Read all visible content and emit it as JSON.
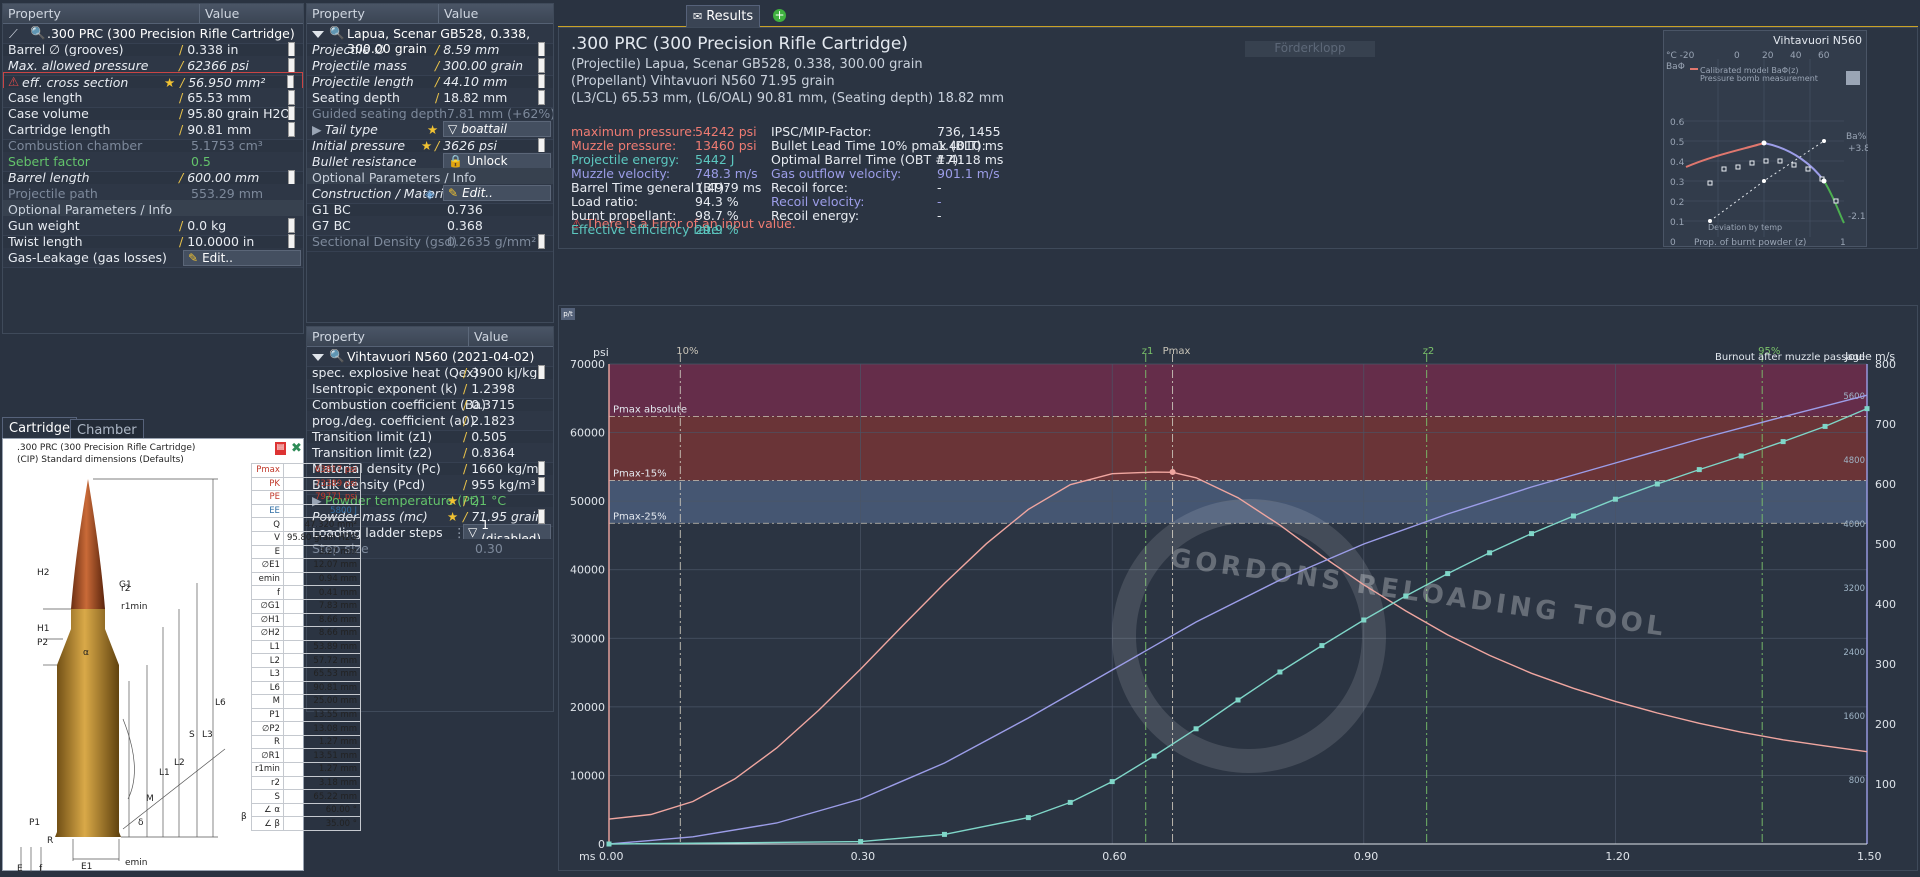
{
  "cartridge_panel": {
    "header": {
      "property": "Property",
      "value": "Value"
    },
    "title": ".300 PRC (300 Precision Rifle Cartridge)",
    "rows": [
      {
        "label": "Barrel ∅ (grooves)",
        "value": "0.338 in"
      },
      {
        "label": "Max. allowed pressure",
        "value": "62366 psi"
      },
      {
        "label": "eff. cross section",
        "value": "56.950 mm²"
      },
      {
        "label": "Case length",
        "value": "65.53 mm"
      },
      {
        "label": "Case volume",
        "value": "95.80 grain H2O"
      },
      {
        "label": "Cartridge length",
        "value": "90.81 mm"
      },
      {
        "label": "Combustion chamber",
        "value": "5.1753 cm³"
      },
      {
        "label": "Sebert factor",
        "value": "0.5"
      },
      {
        "label": "Barrel length",
        "value": "600.00 mm"
      },
      {
        "label": "Projectile path",
        "value": "553.29 mm"
      }
    ],
    "optional_header": "Optional Parameters / Info",
    "optional_rows": [
      {
        "label": "Gun weight",
        "value": "0.0 kg"
      },
      {
        "label": "Twist length",
        "value": "10.0000 in"
      },
      {
        "label": "Gas-Leakage (gas losses)",
        "value": "Edit.."
      }
    ]
  },
  "projectile_panel": {
    "header": {
      "property": "Property",
      "value": "Value"
    },
    "title": "Lapua, Scenar GB528, 0.338, 300.00 grain",
    "rows": [
      {
        "label": "Projectile ∅",
        "value": "8.59 mm"
      },
      {
        "label": "Projectile mass",
        "value": "300.00 grain"
      },
      {
        "label": "Projectile length",
        "value": "44.10 mm"
      },
      {
        "label": "Seating depth",
        "value": "18.82 mm"
      },
      {
        "label": "Guided seating depth",
        "value": "7.81 mm (+62%)"
      },
      {
        "label": "Tail type",
        "value": "boattail"
      },
      {
        "label": "Initial pressure",
        "value": "3626 psi"
      },
      {
        "label": "Bullet resistance",
        "value": "Unlock"
      }
    ],
    "optional_header": "Optional Parameters / Info",
    "optional_rows": [
      {
        "label": "Construction / Material",
        "value": "Edit.."
      },
      {
        "label": "G1 BC",
        "value": "0.736"
      },
      {
        "label": "G7 BC",
        "value": "0.368"
      },
      {
        "label": "Sectional Density (gsd)",
        "value": "0.2635 g/mm²"
      }
    ]
  },
  "powder_panel": {
    "header": {
      "property": "Property",
      "value": "Value"
    },
    "title": "Vihtavuori N560 (2021-04-02)",
    "rows": [
      {
        "label": "spec. explosive heat (Qex)",
        "value": "3900 kJ/kg"
      },
      {
        "label": "Isentropic exponent (k)",
        "value": "1.2398"
      },
      {
        "label": "Combustion coefficient (Ba)",
        "value": "0.3715"
      },
      {
        "label": "prog./deg. coefficient (a0)",
        "value": "2.1823"
      },
      {
        "label": "Transition limit (z1)",
        "value": "0.505"
      },
      {
        "label": "Transition limit (z2)",
        "value": "0.8364"
      },
      {
        "label": "Material density (Pc)",
        "value": "1660 kg/m³"
      },
      {
        "label": "Bulk density (Pcd)",
        "value": "955 kg/m³"
      },
      {
        "label": "Powder temperature (Pt)",
        "value": "21 °C"
      },
      {
        "label": "Powder mass (mc)",
        "value": "71.95 grain"
      },
      {
        "label": "Loading ladder steps",
        "value": "1 (disabled)"
      },
      {
        "label": "Step size",
        "value": "0.30"
      }
    ]
  },
  "drawing_panel": {
    "tabs": [
      "Cartridge",
      "Chamber"
    ],
    "caption1": ".300 PRC (300 Precision Rifle Cartridge)",
    "caption2": "(CIP) Standard dimensions (Defaults)",
    "labels": [
      "H2",
      "G1",
      "r2",
      "r1min",
      "H1",
      "P2",
      "α",
      "L6",
      "L3",
      "S",
      "L2",
      "L1",
      "M",
      "δ",
      "β",
      "P1",
      "R",
      "E",
      "f",
      "E1",
      "R1",
      "emin"
    ],
    "dims": [
      {
        "k": "Pmax",
        "v": "63817 psi",
        "c": "#c0392b"
      },
      {
        "k": "PK",
        "v": "73389 psi",
        "c": "#c0392b"
      },
      {
        "k": "PE",
        "v": "79771 psi",
        "c": "#c0392b"
      },
      {
        "k": "EE",
        "v": "5800 J",
        "c": "#2e6da4"
      },
      {
        "k": "Q",
        "v": "47.320 mm²",
        "c": "#222"
      },
      {
        "k": "V",
        "v": "95.80 grain H2O",
        "c": "#222"
      },
      {
        "k": "E",
        "v": "3.27 mm",
        "c": "#222"
      },
      {
        "k": "∅E1",
        "v": "12.07 mm",
        "c": "#222"
      },
      {
        "k": "emin",
        "v": "0.94 mm",
        "c": "#222"
      },
      {
        "k": "f",
        "v": "0.41 mm",
        "c": "#222"
      },
      {
        "k": "∅G1",
        "v": "7.83 mm",
        "c": "#222"
      },
      {
        "k": "∅H1",
        "v": "8.66 mm",
        "c": "#222"
      },
      {
        "k": "∅H2",
        "v": "8.66 mm",
        "c": "#222"
      },
      {
        "k": "L1",
        "v": "53.89 mm",
        "c": "#222"
      },
      {
        "k": "L2",
        "v": "57.72 mm",
        "c": "#222"
      },
      {
        "k": "L3",
        "v": "65.53 mm",
        "c": "#222"
      },
      {
        "k": "L6",
        "v": "90.81 mm",
        "c": "#222"
      },
      {
        "k": "M",
        "v": "25.00 mm",
        "c": "#222"
      },
      {
        "k": "P1",
        "v": "13.55 mm",
        "c": "#222"
      },
      {
        "k": "∅P2",
        "v": "13.08 mm",
        "c": "#222"
      },
      {
        "k": "R",
        "v": "1.27 mm",
        "c": "#222"
      },
      {
        "k": "∅R1",
        "v": "13.51 mm",
        "c": "#222"
      },
      {
        "k": "r1min",
        "v": "1.27 mm",
        "c": "#222"
      },
      {
        "k": "r2",
        "v": "3.18 mm",
        "c": "#222"
      },
      {
        "k": "S",
        "v": "65.22 mm",
        "c": "#222"
      },
      {
        "k": "∠ α",
        "v": "60.00 °",
        "c": "#222"
      },
      {
        "k": "∠ β",
        "v": "35.00 °",
        "c": "#222"
      }
    ]
  },
  "results": {
    "tab": "Results",
    "watermark_button": "Förderklopp",
    "title": ".300 PRC (300 Precision Rifle Cartridge)",
    "lines": [
      "(Projectile) Lapua, Scenar GB528, 0.338, 300.00 grain",
      "(Propellant) Vihtavuori N560 71.95 grain",
      "(L3/CL) 65.53 mm, (L6/OAL) 90.81 mm, (Seating depth) 18.82 mm"
    ],
    "left": [
      {
        "label": "maximum pressure:",
        "value": "54242 psi",
        "color": "#ef7b72"
      },
      {
        "label": "Muzzle pressure:",
        "value": "13460 psi",
        "color": "#ef7b72"
      },
      {
        "label": "Projectile energy:",
        "value": "5442 J",
        "color": "#5cc8c0"
      },
      {
        "label": "Muzzle velocity:",
        "value": "748.3 m/s",
        "color": "#9c9de8"
      },
      {
        "label": "Barrel Time general (BT):",
        "value": "1.4979 ms",
        "color": "#e8ecf2"
      },
      {
        "label": "Load ratio:",
        "value": "94.3 %",
        "color": "#e8ecf2"
      },
      {
        "label": "burnt propellant:",
        "value": "98.7 %",
        "color": "#e8ecf2"
      },
      {
        "label": "Effective efficiency rate:",
        "value": "29.9 %",
        "color": "#5cc8c0"
      }
    ],
    "right": [
      {
        "label": "IPSC/MIP-Factor:",
        "value": "736, 1455",
        "color": "#e8ecf2"
      },
      {
        "label": "Bullet Lead Time 10% pmax (BLT):",
        "value": "1.4010 ms",
        "color": "#e8ecf2"
      },
      {
        "label": "Optimal Barrel Time (OBT #7):",
        "value": "1.4118 ms",
        "color": "#e8ecf2"
      },
      {
        "label": "Gas outflow velocity:",
        "value": "901.1 m/s",
        "color": "#9c9de8"
      },
      {
        "label": "Recoil force:",
        "value": "-",
        "color": "#e8ecf2"
      },
      {
        "label": "Recoil velocity:",
        "value": "-",
        "color": "#9c9de8"
      },
      {
        "label": "Recoil energy:",
        "value": "-",
        "color": "#e8ecf2"
      }
    ],
    "error": "There is a Error of an input value."
  },
  "mini_chart": {
    "title": "Vihtavuori N560",
    "legend": [
      "Calibrated model BaΦ(z)",
      "Pressure bomb measurement"
    ],
    "top_ticks": [
      "°C -20",
      "0",
      "20",
      "40",
      "60"
    ],
    "left_label": "BaΦ",
    "right_label": "Ba%",
    "right_ticks": [
      "+3.8",
      "-2.1"
    ],
    "y_ticks": [
      "0.6",
      "0.5",
      "0.4",
      "0.3",
      "0.2",
      "0.1"
    ],
    "x_label": "Prop. of burnt powder (z)",
    "x_ticks": [
      "0",
      "1"
    ],
    "deviation": "Deviation by temp"
  },
  "chart_data": {
    "type": "line",
    "x_unit": "ms",
    "x_ticks": [
      "0.00",
      "0.30",
      "0.60",
      "0.90",
      "1.20",
      "1.50"
    ],
    "xlim": [
      0,
      1.5
    ],
    "y_left_unit": "psi",
    "y_left_ticks": [
      "0",
      "10000",
      "20000",
      "30000",
      "40000",
      "50000",
      "60000",
      "70000"
    ],
    "ylim": [
      0,
      70000
    ],
    "y_joule_unit": "Joule",
    "y_joule_ticks": [
      "800",
      "1600",
      "2400",
      "3200",
      "4000",
      "4800",
      "5600"
    ],
    "y_ms_unit": "m/s",
    "y_ms_ticks": [
      "100",
      "200",
      "300",
      "400",
      "500",
      "600",
      "700",
      "800"
    ],
    "bands": [
      {
        "label": "Pmax absolute",
        "value": 62366,
        "color": "#7a2b4e"
      },
      {
        "label": "Pmax-15%",
        "value": 53011,
        "color": "#7b3434"
      },
      {
        "label": "Pmax-25%",
        "value": 46775,
        "color": "#4a5d7a"
      }
    ],
    "markers": [
      {
        "label": "10%",
        "x": 0.085
      },
      {
        "label": "z1",
        "x": 0.64
      },
      {
        "label": "Pmax",
        "x": 0.672
      },
      {
        "label": "z2",
        "x": 0.975
      },
      {
        "label": "95%",
        "x": 1.375
      }
    ],
    "annotation": "Burnout after muzzle passage",
    "watermark": "GORDONS RELOADING TOOL",
    "series": [
      {
        "name": "pressure",
        "color": "#f0a6a0",
        "x": [
          0,
          0.05,
          0.1,
          0.15,
          0.2,
          0.25,
          0.3,
          0.35,
          0.4,
          0.45,
          0.5,
          0.55,
          0.6,
          0.65,
          0.672,
          0.7,
          0.75,
          0.8,
          0.85,
          0.9,
          0.95,
          1.0,
          1.05,
          1.1,
          1.15,
          1.2,
          1.25,
          1.3,
          1.35,
          1.4,
          1.45,
          1.5
        ],
        "y": [
          3626,
          4300,
          6200,
          9500,
          14000,
          19500,
          25500,
          31800,
          38000,
          43800,
          48800,
          52400,
          54000,
          54242,
          54200,
          53400,
          50500,
          46500,
          42000,
          37800,
          34000,
          30500,
          27500,
          24900,
          22700,
          20800,
          19100,
          17600,
          16300,
          15200,
          14300,
          13460
        ]
      },
      {
        "name": "velocity",
        "color": "#9c9de8",
        "x": [
          0,
          0.1,
          0.2,
          0.3,
          0.4,
          0.5,
          0.6,
          0.7,
          0.8,
          0.9,
          1.0,
          1.1,
          1.2,
          1.3,
          1.4,
          1.5
        ],
        "y": [
          0,
          12,
          35,
          75,
          135,
          210,
          290,
          370,
          440,
          500,
          550,
          595,
          635,
          675,
          712,
          748
        ]
      },
      {
        "name": "energy",
        "color": "#7fd6c8",
        "x": [
          0,
          0.3,
          0.4,
          0.5,
          0.55,
          0.6,
          0.65,
          0.7,
          0.75,
          0.8,
          0.85,
          0.9,
          0.95,
          1.0,
          1.05,
          1.1,
          1.15,
          1.2,
          1.25,
          1.3,
          1.35,
          1.4,
          1.45,
          1.5
        ],
        "y": [
          0,
          30,
          120,
          330,
          520,
          780,
          1100,
          1440,
          1800,
          2150,
          2480,
          2800,
          3100,
          3380,
          3640,
          3880,
          4100,
          4310,
          4500,
          4680,
          4850,
          5030,
          5220,
          5442
        ]
      }
    ]
  }
}
